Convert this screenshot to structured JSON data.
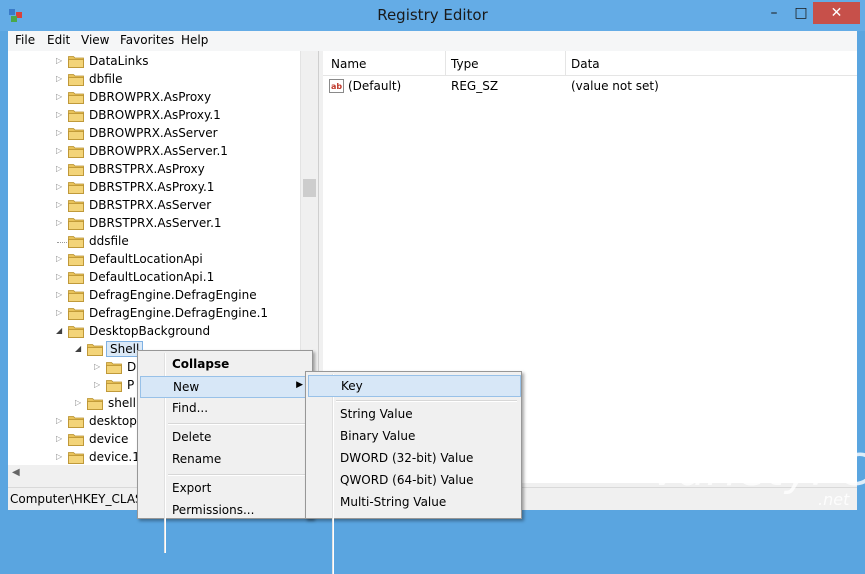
{
  "window": {
    "title": "Registry Editor",
    "close_glyph": "✕",
    "min_glyph": "–",
    "max_glyph": "□"
  },
  "menu": [
    "File",
    "Edit",
    "View",
    "Favorites",
    "Help"
  ],
  "tree": {
    "items": [
      {
        "label": "DataLinks",
        "indent": 0,
        "expander": "collapsed"
      },
      {
        "label": "dbfile",
        "indent": 0,
        "expander": "collapsed"
      },
      {
        "label": "DBROWPRX.AsProxy",
        "indent": 0,
        "expander": "collapsed"
      },
      {
        "label": "DBROWPRX.AsProxy.1",
        "indent": 0,
        "expander": "collapsed"
      },
      {
        "label": "DBROWPRX.AsServer",
        "indent": 0,
        "expander": "collapsed"
      },
      {
        "label": "DBROWPRX.AsServer.1",
        "indent": 0,
        "expander": "collapsed"
      },
      {
        "label": "DBRSTPRX.AsProxy",
        "indent": 0,
        "expander": "collapsed"
      },
      {
        "label": "DBRSTPRX.AsProxy.1",
        "indent": 0,
        "expander": "collapsed"
      },
      {
        "label": "DBRSTPRX.AsServer",
        "indent": 0,
        "expander": "collapsed"
      },
      {
        "label": "DBRSTPRX.AsServer.1",
        "indent": 0,
        "expander": "collapsed"
      },
      {
        "label": "ddsfile",
        "indent": 0,
        "expander": "none"
      },
      {
        "label": "DefaultLocationApi",
        "indent": 0,
        "expander": "collapsed"
      },
      {
        "label": "DefaultLocationApi.1",
        "indent": 0,
        "expander": "collapsed"
      },
      {
        "label": "DefragEngine.DefragEngine",
        "indent": 0,
        "expander": "collapsed"
      },
      {
        "label": "DefragEngine.DefragEngine.1",
        "indent": 0,
        "expander": "collapsed"
      },
      {
        "label": "DesktopBackground",
        "indent": 0,
        "expander": "expanded"
      },
      {
        "label": "Shell",
        "indent": 1,
        "expander": "expanded",
        "selected": true
      },
      {
        "label": "D",
        "indent": 2,
        "expander": "collapsed"
      },
      {
        "label": "P",
        "indent": 2,
        "expander": "collapsed"
      },
      {
        "label": "shell",
        "indent": 1,
        "expander": "collapsed"
      },
      {
        "label": "desktopt",
        "indent": 0,
        "expander": "collapsed"
      },
      {
        "label": "device",
        "indent": 0,
        "expander": "collapsed"
      },
      {
        "label": "device.1",
        "indent": 0,
        "expander": "collapsed"
      }
    ]
  },
  "list": {
    "columns": [
      "Name",
      "Type",
      "Data"
    ],
    "rows": [
      {
        "name": "(Default)",
        "type": "REG_SZ",
        "data": "(value not set)",
        "icon": "string-value-icon"
      }
    ]
  },
  "status": {
    "path": "Computer\\HKEY_CLASS"
  },
  "context_menu": {
    "items": [
      {
        "label": "Collapse",
        "bold": true
      },
      {
        "label": "New",
        "submenu": true,
        "highlighted": true
      },
      {
        "label": "Find..."
      },
      {
        "separator": true
      },
      {
        "label": "Delete"
      },
      {
        "label": "Rename"
      },
      {
        "separator": true
      },
      {
        "label": "Export"
      },
      {
        "label": "Permissions..."
      }
    ]
  },
  "new_submenu": {
    "items": [
      {
        "label": "Key",
        "highlighted": true
      },
      {
        "separator": true
      },
      {
        "label": "String Value"
      },
      {
        "label": "Binary Value"
      },
      {
        "label": "DWORD (32-bit) Value"
      },
      {
        "label": "QWORD (64-bit) Value"
      },
      {
        "label": "Multi-String Value"
      }
    ]
  },
  "watermark": {
    "text": "VarietyPC",
    "suffix": ".net"
  },
  "colors": {
    "title_bar": "#64ace6",
    "close_button": "#c7504a",
    "selection": "#dbe9f7",
    "menu_highlight": "#d7e7f7",
    "folder": "#e8c25a"
  }
}
